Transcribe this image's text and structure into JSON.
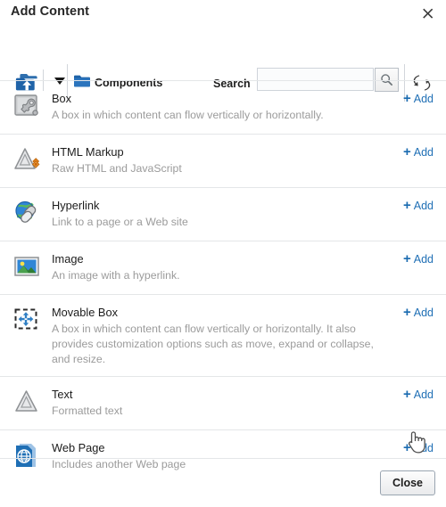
{
  "dialog": {
    "title": "Add Content",
    "close_icon": "close-icon"
  },
  "toolbar": {
    "up_icon": "folder-up-icon",
    "dropdown_icon": "chevron-down-icon",
    "folder_icon": "folder-icon",
    "folder_label": "Components",
    "search_label": "Search",
    "search_value": "",
    "search_placeholder": "",
    "search_icon": "search-icon",
    "refresh_icon": "refresh-icon"
  },
  "items": [
    {
      "icon": "box-wrench-icon",
      "title": "Box",
      "desc": "A box in which content can flow vertically or horizontally.",
      "add_label": "Add",
      "add_plus": "+"
    },
    {
      "icon": "html-markup-icon",
      "title": "HTML Markup",
      "desc": "Raw HTML and JavaScript",
      "add_label": "Add",
      "add_plus": "+"
    },
    {
      "icon": "hyperlink-globe-icon",
      "title": "Hyperlink",
      "desc": "Link to a page or a Web site",
      "add_label": "Add",
      "add_plus": "+"
    },
    {
      "icon": "image-icon",
      "title": "Image",
      "desc": "An image with a hyperlink.",
      "add_label": "Add",
      "add_plus": "+"
    },
    {
      "icon": "movable-box-icon",
      "title": "Movable Box",
      "desc": "A box in which content can flow vertically or horizontally. It also provides customization options such as move, expand or collapse, and resize.",
      "add_label": "Add",
      "add_plus": "+"
    },
    {
      "icon": "text-letter-a-icon",
      "title": "Text",
      "desc": "Formatted text",
      "add_label": "Add",
      "add_plus": "+"
    },
    {
      "icon": "web-page-globe-icon",
      "title": "Web Page",
      "desc": "Includes another Web page",
      "add_label": "Add",
      "add_plus": "+"
    }
  ],
  "footer": {
    "close_label": "Close"
  },
  "colors": {
    "link_blue": "#1f6fb5",
    "accent_blue": "#1a6bb0",
    "text_dark": "#1c1c1c",
    "text_muted": "#9b9b9b",
    "divider": "#e4e6e8"
  },
  "cursor": {
    "icon": "hand-pointer-cursor"
  }
}
